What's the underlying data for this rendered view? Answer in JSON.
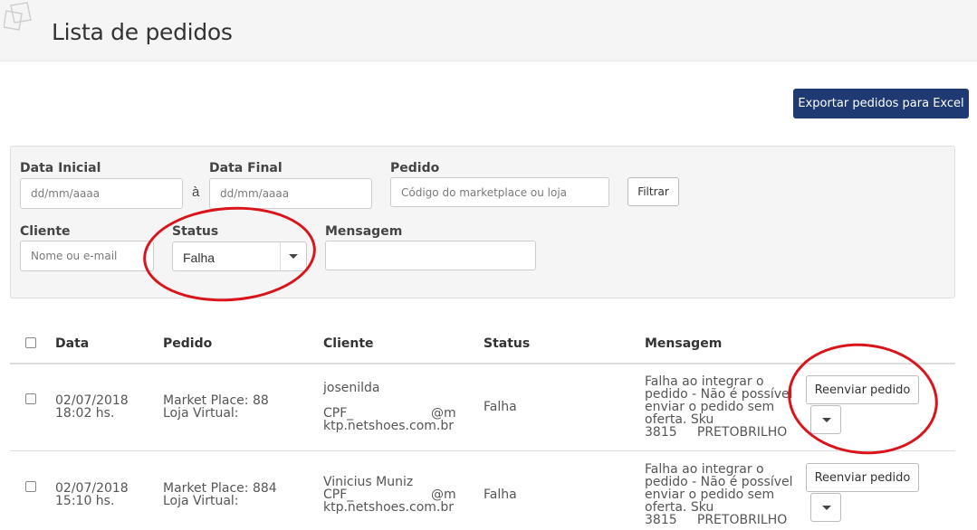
{
  "header": {
    "title": "Lista de pedidos",
    "icon": "document-stack-icon"
  },
  "toolbar": {
    "export_label": "Exportar pedidos para Excel"
  },
  "filters": {
    "data_inicial": {
      "label": "Data Inicial",
      "placeholder": "dd/mm/aaaa"
    },
    "separator": "à",
    "data_final": {
      "label": "Data Final",
      "placeholder": "dd/mm/aaaa"
    },
    "pedido": {
      "label": "Pedido",
      "placeholder": "Código do marketplace ou loja"
    },
    "filter_button": "Filtrar",
    "cliente": {
      "label": "Cliente",
      "placeholder": "Nome ou e-mail"
    },
    "status": {
      "label": "Status",
      "value": "Falha"
    },
    "mensagem": {
      "label": "Mensagem",
      "value": ""
    }
  },
  "table": {
    "headers": {
      "data": "Data",
      "pedido": "Pedido",
      "cliente": "Cliente",
      "status": "Status",
      "mensagem": "Mensagem"
    },
    "rows": [
      {
        "date": "02/07/2018",
        "time": "18:02 hs.",
        "pedido_mp": "Market Place: 88",
        "pedido_lv": "Loja Virtual:",
        "cliente_nome": "josenilda",
        "cliente_cpf": "CPF_",
        "cliente_email_a": "@m",
        "cliente_email_b": "ktp.netshoes.com.br",
        "status": "Falha",
        "msg_1": "Falha ao integrar o",
        "msg_2": "pedido - Não é possível",
        "msg_3": "enviar o pedido sem",
        "msg_4": "oferta. Sku",
        "msg_5": "3815     PRETOBRILHO",
        "resend_label": "Reenviar pedido"
      },
      {
        "date": "02/07/2018",
        "time": "15:10 hs.",
        "pedido_mp": "Market Place: 884",
        "pedido_lv": "Loja Virtual:",
        "cliente_nome": "Vinicius Muniz",
        "cliente_cpf": "CPF_",
        "cliente_email_a": "@m",
        "cliente_email_b": "ktp.netshoes.com.br",
        "status": "Falha",
        "msg_1": "Falha ao integrar o",
        "msg_2": "pedido - Não é possível",
        "msg_3": "enviar o pedido sem",
        "msg_4": "oferta. Sku",
        "msg_5": "3815     PRETOBRILHO",
        "resend_label": "Reenviar pedido"
      }
    ]
  },
  "colors": {
    "primary": "#1f3a73",
    "annotation": "#d9141b",
    "panel": "#f5f5f5"
  }
}
